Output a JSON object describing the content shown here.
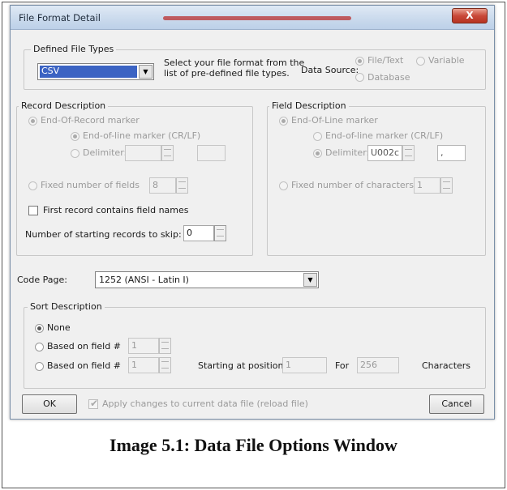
{
  "window": {
    "title": "File Format Detail",
    "close_glyph": "X"
  },
  "defined_file_types": {
    "legend": "Defined File Types",
    "selected": "CSV",
    "help_line1": "Select your file format from the",
    "help_line2": "list of pre-defined file types.",
    "data_source_label": "Data Source:",
    "sources": [
      "File/Text",
      "Variable",
      "Database"
    ],
    "selected_source": "File/Text"
  },
  "record_description": {
    "legend": "Record Description",
    "end_of_record": "End-Of-Record marker",
    "end_of_line": "End-of-line marker  (CR/LF)",
    "delimiter_label": "Delimiter:",
    "delimiter_value": "",
    "delimiter_char": "",
    "fixed_fields_label": "Fixed number of fields",
    "fixed_fields_value": "8",
    "first_record_label": "First record contains field names",
    "skip_label": "Number of starting records to skip:",
    "skip_value": "0"
  },
  "field_description": {
    "legend": "Field Description",
    "end_of_line": "End-Of-Line marker",
    "end_of_line_marker": "End-of-line marker  (CR/LF)",
    "delimiter_label": "Delimiter:",
    "delimiter_value": "U002c",
    "delimiter_char": ",",
    "fixed_chars_label": "Fixed number of characters",
    "fixed_chars_value": "1"
  },
  "code_page": {
    "label": "Code Page:",
    "value": "1252  (ANSI - Latin I)"
  },
  "sort_description": {
    "legend": "Sort Description",
    "none_label": "None",
    "based_on_label": "Based on field #",
    "field1_value": "1",
    "field2_value": "1",
    "starting_label": "Starting at position",
    "starting_value": "1",
    "for_label": "For",
    "for_value": "256",
    "characters_label": "Characters"
  },
  "footer": {
    "ok": "OK",
    "apply_label": "Apply changes to current data file (reload file)",
    "cancel": "Cancel"
  },
  "caption": "Image 5.1: Data File Options Window"
}
